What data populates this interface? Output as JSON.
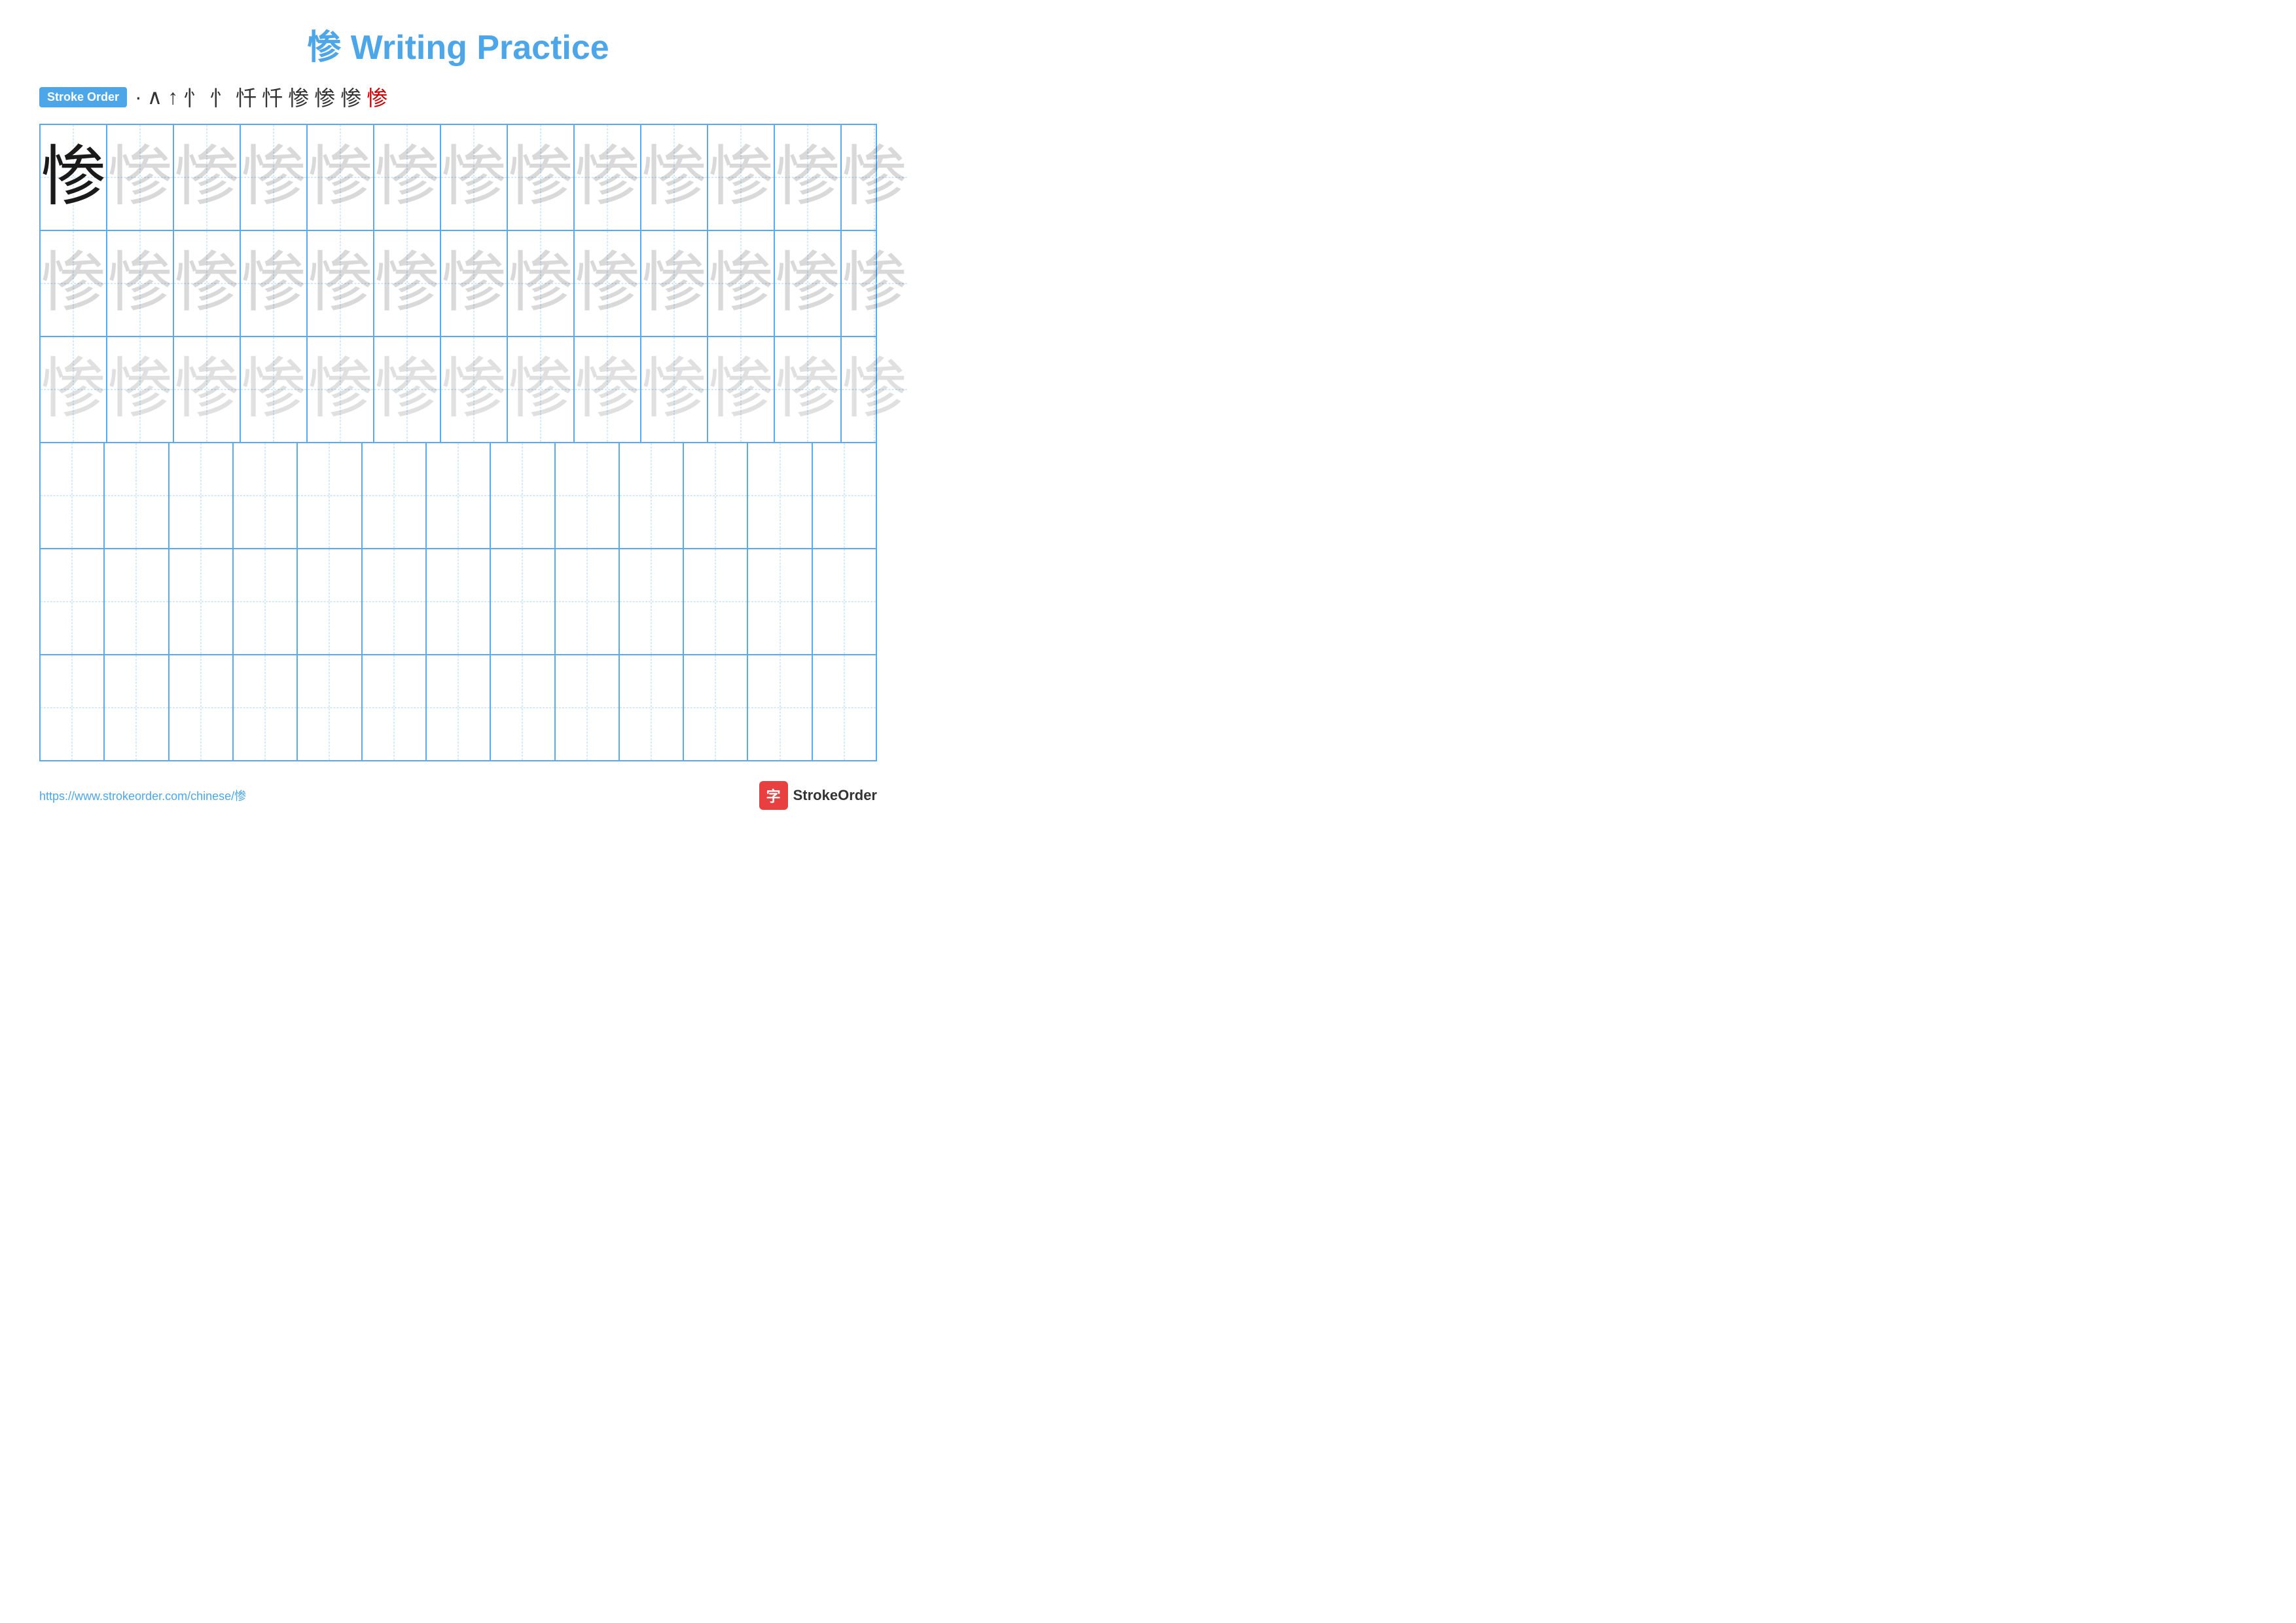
{
  "header": {
    "kanji": "惨",
    "title": "Writing Practice"
  },
  "stroke_order": {
    "badge_label": "Stroke Order",
    "steps": [
      "·",
      "∧",
      "↑",
      "忄",
      "忄'",
      "忏",
      "忏",
      "惨",
      "惨",
      "惨",
      "惨"
    ]
  },
  "grid": {
    "rows": 6,
    "cols": 13,
    "character": "惨",
    "row_types": [
      "dark_then_light",
      "light",
      "lighter",
      "empty",
      "empty",
      "empty"
    ]
  },
  "footer": {
    "url": "https://www.strokeorder.com/chinese/惨",
    "logo_text": "StrokeOrder",
    "logo_icon": "字"
  }
}
